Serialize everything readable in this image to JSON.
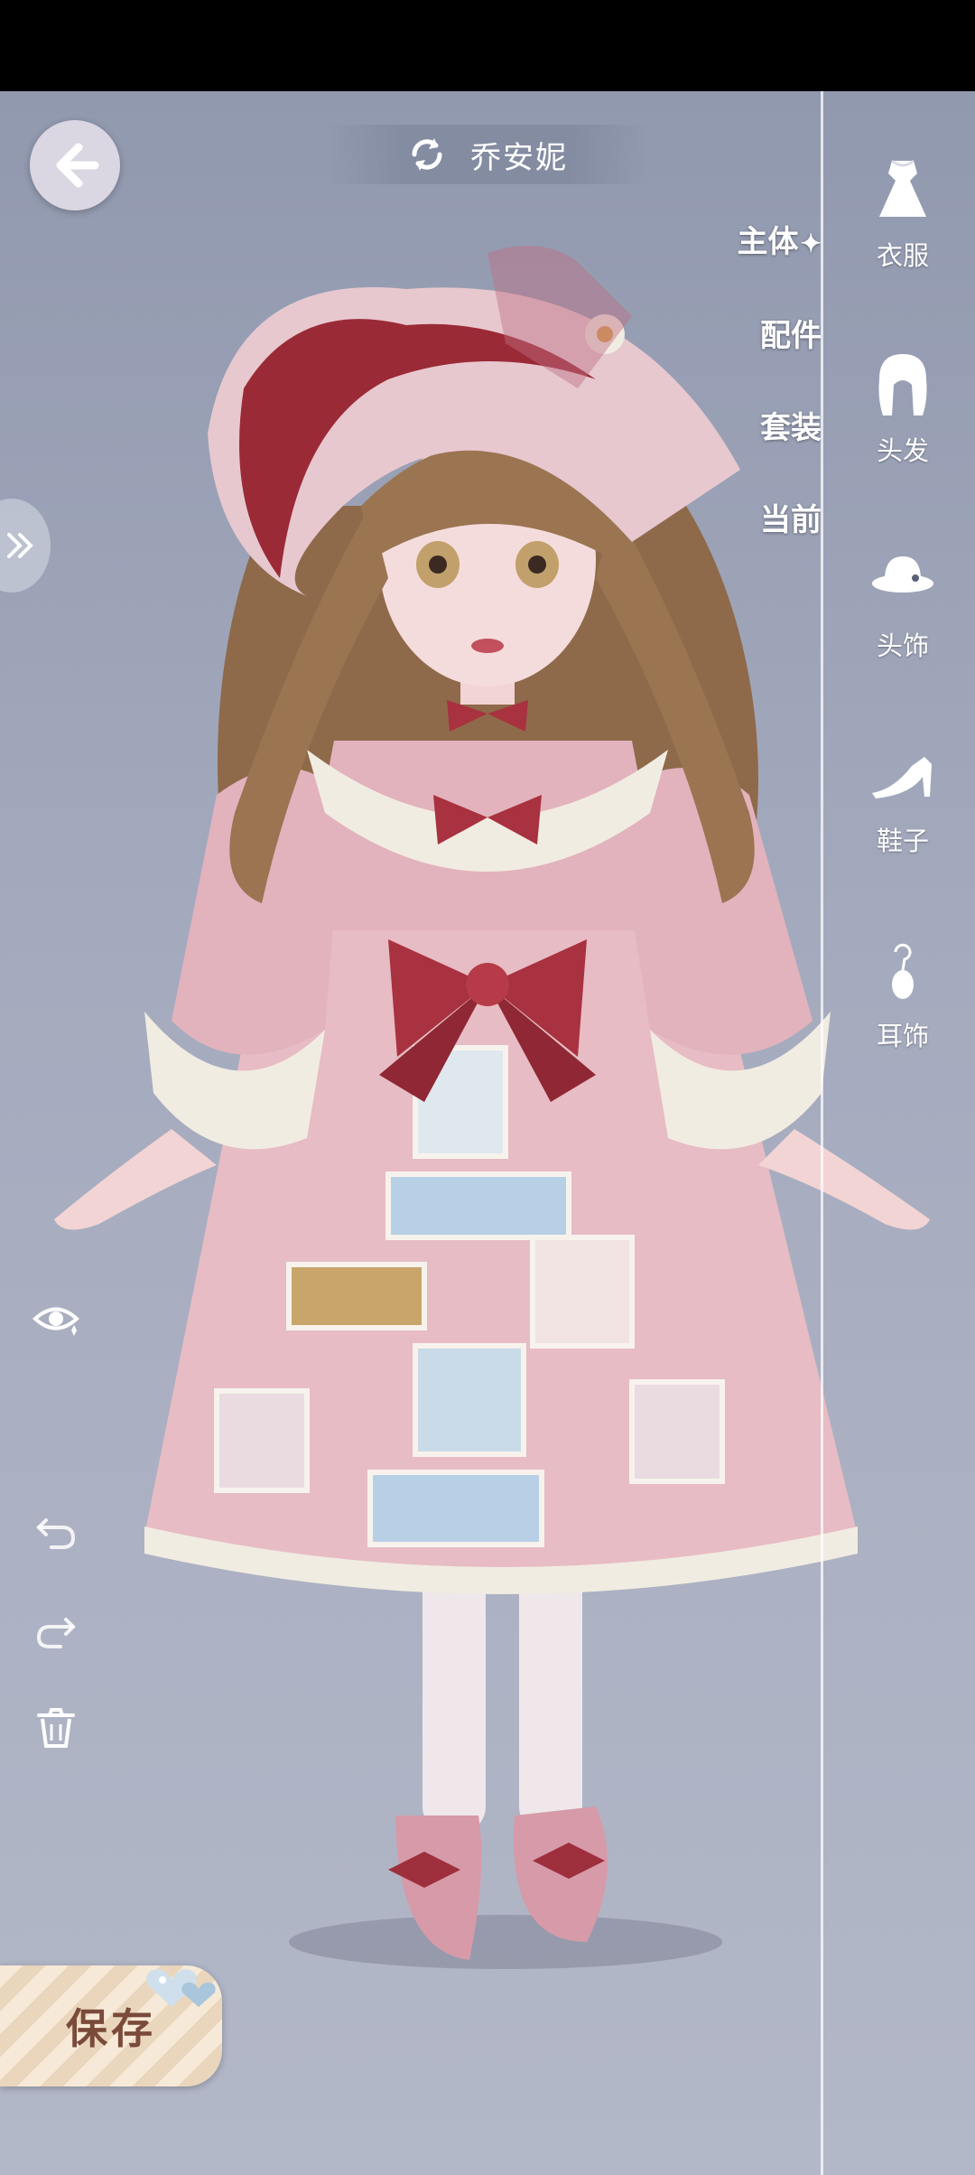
{
  "app": {
    "character_name": "乔安妮"
  },
  "category_menu": {
    "items": [
      {
        "label": "主体",
        "active": true
      },
      {
        "label": "配件",
        "active": false
      },
      {
        "label": "套装",
        "active": false
      },
      {
        "label": "当前",
        "active": false
      }
    ]
  },
  "right_tabs": [
    {
      "label": "衣服",
      "icon": "dress-icon"
    },
    {
      "label": "头发",
      "icon": "hair-icon"
    },
    {
      "label": "头饰",
      "icon": "hat-icon"
    },
    {
      "label": "鞋子",
      "icon": "shoe-icon"
    },
    {
      "label": "耳饰",
      "icon": "earring-icon"
    }
  ],
  "tools": [
    "eye-icon",
    "undo-icon",
    "redo-icon",
    "trash-icon"
  ],
  "save": {
    "label": "保存"
  },
  "colors": {
    "background": "#9ea4b8",
    "dress": "#e7bcc4",
    "bow": "#a8323f",
    "hair": "#9b7452",
    "save_text": "#7a4a3a"
  }
}
